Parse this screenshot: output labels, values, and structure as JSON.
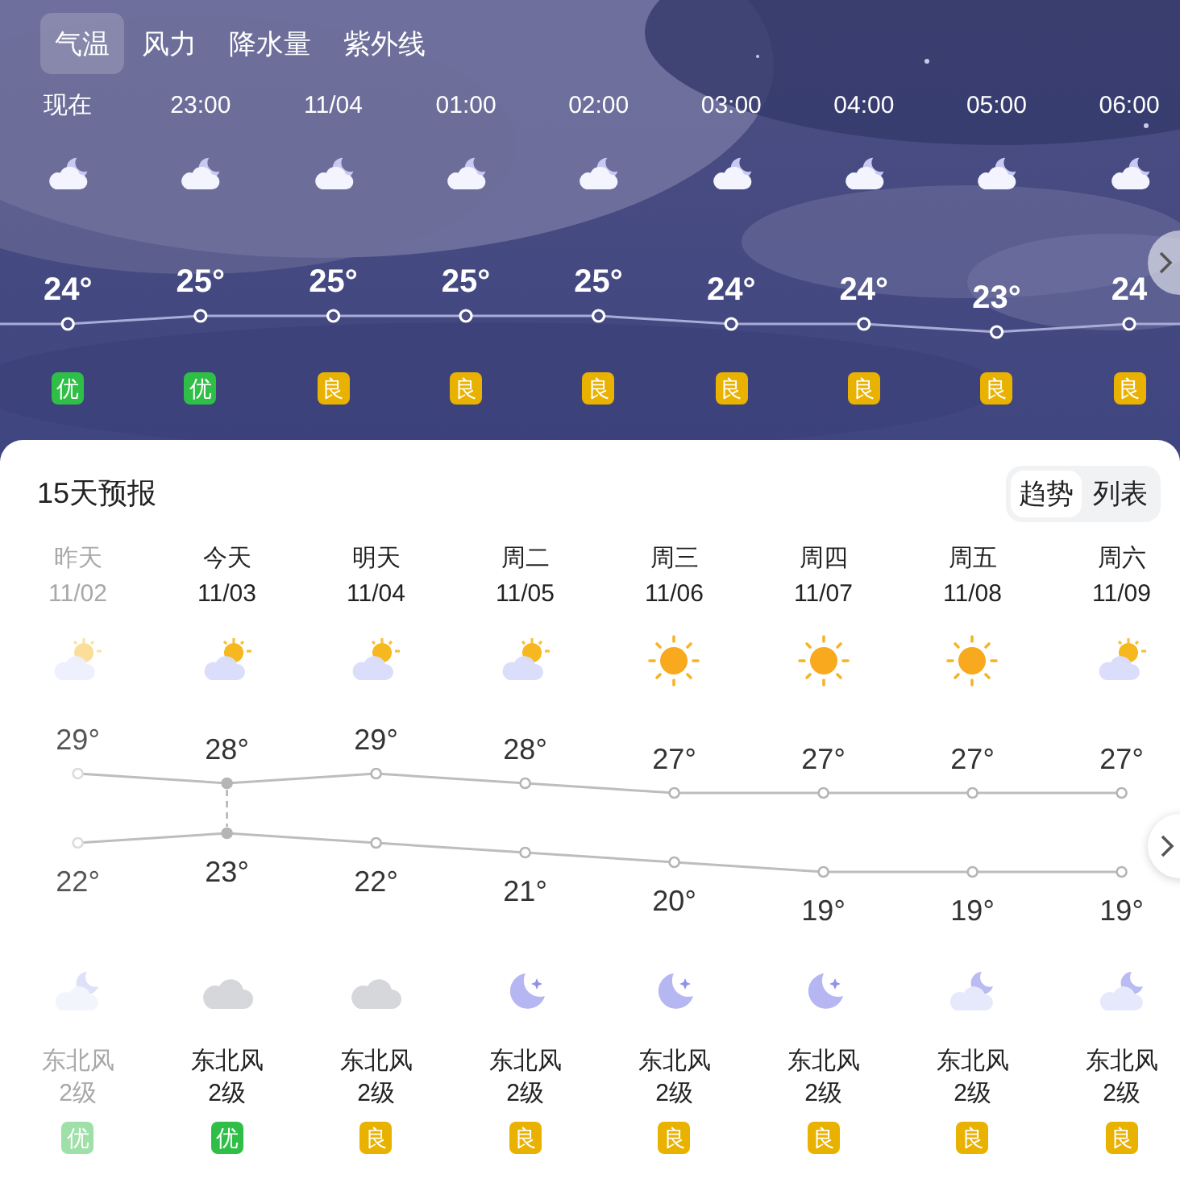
{
  "tabs": [
    {
      "label": "气温",
      "selected": true
    },
    {
      "label": "风力",
      "selected": false
    },
    {
      "label": "降水量",
      "selected": false
    },
    {
      "label": "紫外线",
      "selected": false
    }
  ],
  "hourly": [
    {
      "time": "现在",
      "temp": "24°",
      "aqi": "优",
      "color": "#2fbf47"
    },
    {
      "time": "23:00",
      "temp": "25°",
      "aqi": "优",
      "color": "#2fbf47"
    },
    {
      "time": "11/04",
      "temp": "25°",
      "aqi": "良",
      "color": "#e9b200"
    },
    {
      "time": "01:00",
      "temp": "25°",
      "aqi": "良",
      "color": "#e9b200"
    },
    {
      "time": "02:00",
      "temp": "25°",
      "aqi": "良",
      "color": "#e9b200"
    },
    {
      "time": "03:00",
      "temp": "24°",
      "aqi": "良",
      "color": "#e9b200"
    },
    {
      "time": "04:00",
      "temp": "24°",
      "aqi": "良",
      "color": "#e9b200"
    },
    {
      "time": "05:00",
      "temp": "23°",
      "aqi": "良",
      "color": "#e9b200"
    },
    {
      "time": "06:00",
      "temp": "24",
      "aqi": "良",
      "color": "#e9b200"
    }
  ],
  "forecast": {
    "title": "15天预报",
    "views": [
      {
        "label": "趋势",
        "selected": true
      },
      {
        "label": "列表",
        "selected": false
      }
    ],
    "days": [
      {
        "name": "昨天",
        "date": "11/02",
        "day_icon": {
          "kind": "partly-cloudy"
        },
        "high": "29°",
        "low": "22°",
        "night_icon": {
          "kind": "moon-cloud"
        },
        "wind": "东北风",
        "wind_level": "2级",
        "aqi": "优",
        "color": "#9ee0a8",
        "past": true,
        "today": false
      },
      {
        "name": "今天",
        "date": "11/03",
        "day_icon": {
          "kind": "partly-cloudy"
        },
        "high": "28°",
        "low": "23°",
        "night_icon": {
          "kind": "cloudy"
        },
        "wind": "东北风",
        "wind_level": "2级",
        "aqi": "优",
        "color": "#2fbf47",
        "past": false,
        "today": true
      },
      {
        "name": "明天",
        "date": "11/04",
        "day_icon": {
          "kind": "partly-cloudy"
        },
        "high": "29°",
        "low": "22°",
        "night_icon": {
          "kind": "cloudy"
        },
        "wind": "东北风",
        "wind_level": "2级",
        "aqi": "良",
        "color": "#e9b200",
        "past": false,
        "today": false
      },
      {
        "name": "周二",
        "date": "11/05",
        "day_icon": {
          "kind": "partly-cloudy"
        },
        "high": "28°",
        "low": "21°",
        "night_icon": {
          "kind": "moon"
        },
        "wind": "东北风",
        "wind_level": "2级",
        "aqi": "良",
        "color": "#e9b200",
        "past": false,
        "today": false
      },
      {
        "name": "周三",
        "date": "11/06",
        "day_icon": {
          "kind": "sunny"
        },
        "high": "27°",
        "low": "20°",
        "night_icon": {
          "kind": "moon"
        },
        "wind": "东北风",
        "wind_level": "2级",
        "aqi": "良",
        "color": "#e9b200",
        "past": false,
        "today": false
      },
      {
        "name": "周四",
        "date": "11/07",
        "day_icon": {
          "kind": "sunny"
        },
        "high": "27°",
        "low": "19°",
        "night_icon": {
          "kind": "moon"
        },
        "wind": "东北风",
        "wind_level": "2级",
        "aqi": "良",
        "color": "#e9b200",
        "past": false,
        "today": false
      },
      {
        "name": "周五",
        "date": "11/08",
        "day_icon": {
          "kind": "sunny"
        },
        "high": "27°",
        "low": "19°",
        "night_icon": {
          "kind": "moon-cloud"
        },
        "wind": "东北风",
        "wind_level": "2级",
        "aqi": "良",
        "color": "#e9b200",
        "past": false,
        "today": false
      },
      {
        "name": "周六",
        "date": "11/09",
        "day_icon": {
          "kind": "partly-cloudy"
        },
        "high": "27°",
        "low": "19°",
        "night_icon": {
          "kind": "moon-cloud"
        },
        "wind": "东北风",
        "wind_level": "2级",
        "aqi": "良",
        "color": "#e9b200",
        "past": false,
        "today": false
      }
    ]
  }
}
